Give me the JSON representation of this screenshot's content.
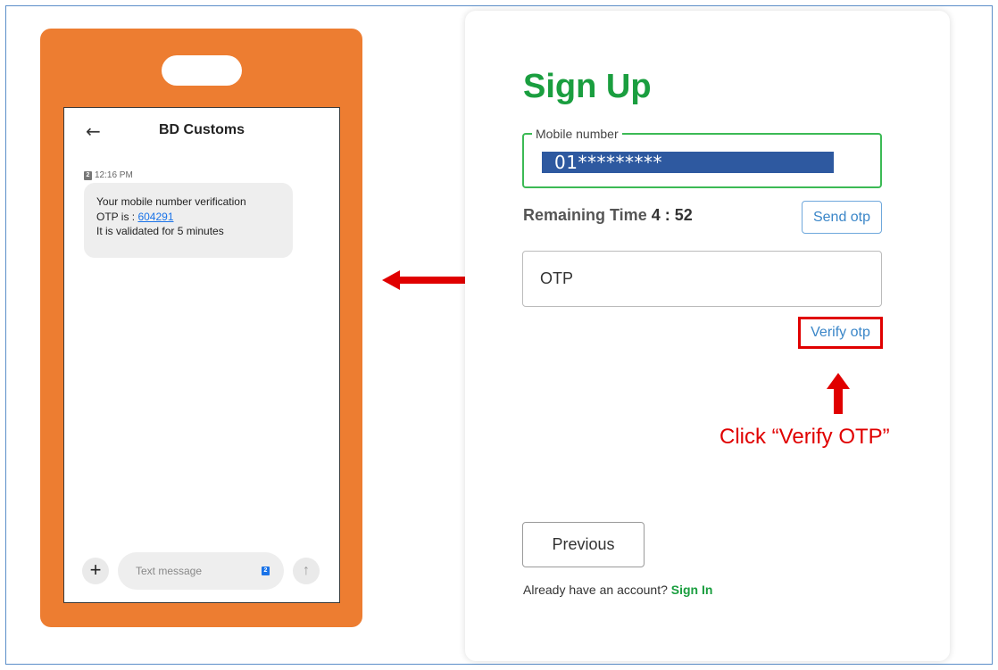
{
  "phone": {
    "header": {
      "back_icon": "←",
      "title": "BD Customs"
    },
    "message": {
      "time": "12:16 PM",
      "sim_badge": "2",
      "line1": "Your mobile number verification",
      "otp_prefix": "OTP is : ",
      "otp_code": "604291",
      "line3": "It is validated for 5 minutes"
    },
    "composer": {
      "plus": "+",
      "placeholder": "Text message",
      "sim_badge": "2",
      "send_icon": "↑"
    }
  },
  "signup": {
    "title": "Sign Up",
    "mobile_label": "Mobile number",
    "mobile_value": "01*********",
    "remaining_label": "Remaining Time",
    "remaining_value": "4 : 52",
    "send_otp": "Send otp",
    "otp_placeholder": "OTP",
    "verify_otp": "Verify otp",
    "previous": "Previous",
    "account_text": "Already have an account?",
    "sign_in": "Sign In"
  },
  "annotation": {
    "text": "Click “Verify OTP”",
    "color": "#e00000"
  },
  "colors": {
    "phone_body": "#ed7d31",
    "brand_green": "#1a9e3f",
    "link_blue": "#3a86c8",
    "mask_blue": "#2e59a0"
  }
}
